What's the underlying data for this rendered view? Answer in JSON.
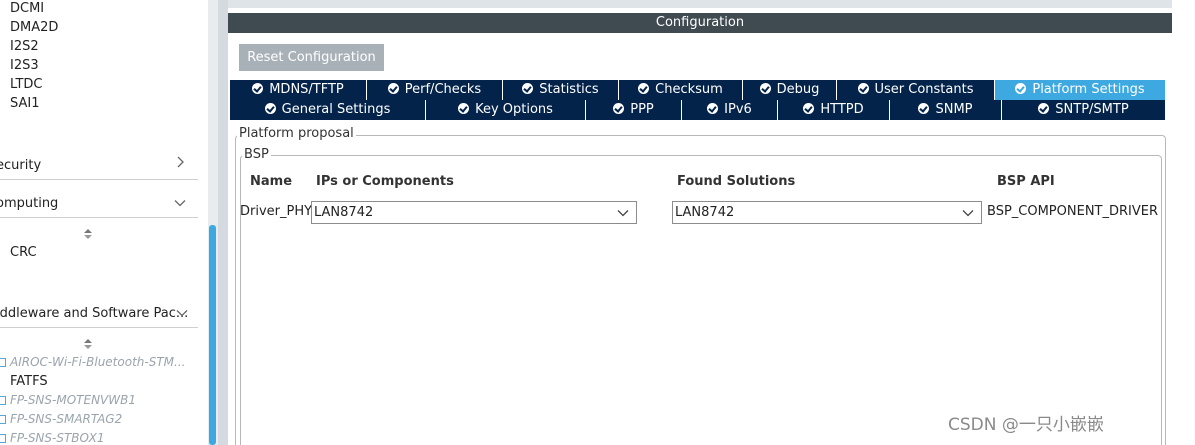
{
  "sidebar": {
    "peripherals": [
      "DCMI",
      "DMA2D",
      "I2S2",
      "I2S3",
      "LTDC",
      "SAI1"
    ],
    "categories": [
      {
        "label": "ecurity"
      },
      {
        "label": "omputing"
      },
      {
        "label": "iddleware and Software Pac..."
      }
    ],
    "computing_items": [
      "CRC"
    ],
    "packs": [
      {
        "label": "AIROC-Wi-Fi-Bluetooth-STM...",
        "enabled": false
      },
      {
        "label": "FATFS",
        "enabled": true
      },
      {
        "label": "FP-SNS-MOTENVWB1",
        "enabled": false
      },
      {
        "label": "FP-SNS-SMARTAG2",
        "enabled": false
      },
      {
        "label": "FP-SNS-STBOX1",
        "enabled": false
      }
    ]
  },
  "configuration": {
    "title": "Configuration",
    "reset_label": "Reset Configuration",
    "tabs_row1": [
      "MDNS/TFTP",
      "Perf/Checks",
      "Statistics",
      "Checksum",
      "Debug",
      "User Constants",
      "Platform Settings"
    ],
    "tabs_row2": [
      "General Settings",
      "Key Options",
      "PPP",
      "IPv6",
      "HTTPD",
      "SNMP",
      "SNTP/SMTP"
    ],
    "active_tab": "Platform Settings",
    "platform_proposal_label": "Platform proposal",
    "bsp_label": "BSP",
    "columns": [
      "Name",
      "IPs or Components",
      "Found Solutions",
      "BSP API"
    ],
    "row": {
      "name": "Driver_PHY",
      "component": "LAN8742",
      "solution": "LAN8742",
      "api": "BSP_COMPONENT_DRIVER"
    }
  },
  "watermark": "CSDN @一只小嵌嵌",
  "colors": {
    "tab_bg": "#03234b",
    "tab_active": "#3ea8e0",
    "header_bg": "#3f4a51",
    "reset_btn": "#a9b1b8"
  }
}
